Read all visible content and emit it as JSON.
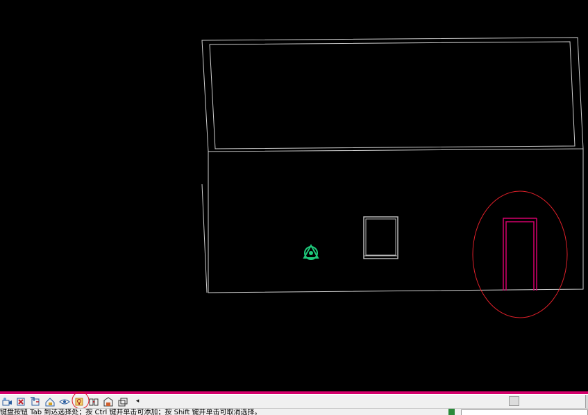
{
  "viewport": {
    "background": "#000000",
    "wall_color": "#cfcfcf",
    "door_color": "#d4006b",
    "highlight_color": "#e0202a",
    "camera_color": "#1ec87a",
    "window_color": "#b8b8b8"
  },
  "toolbar": {
    "accent_color": "#d4006b",
    "buttons": [
      {
        "icon": "visual-style-icon"
      },
      {
        "icon": "hide-crop-icon"
      },
      {
        "icon": "show-crop-icon"
      },
      {
        "icon": "unlock-view-icon"
      },
      {
        "icon": "temporary-hide-icon"
      },
      {
        "icon": "reveal-hidden-elements-icon",
        "highlighted": true
      },
      {
        "icon": "worksharing-icon"
      },
      {
        "icon": "design-options-icon"
      },
      {
        "icon": "analytical-model-icon"
      }
    ],
    "scroll_left_glyph": "◂"
  },
  "status": {
    "text": "键盘按钮 Tab 到达选择处；按 Ctrl 键并单击可添加；按 Shift 键并单击可取消选择。",
    "field_value": ""
  }
}
